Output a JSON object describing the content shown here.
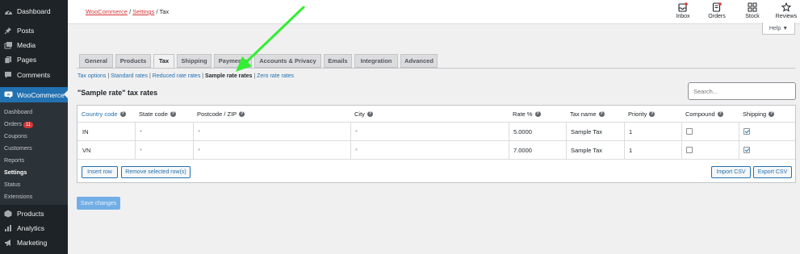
{
  "sidebar": {
    "top": [
      {
        "label": "Dashboard",
        "icon": "dashboard-icon"
      },
      {
        "label": "Posts",
        "icon": "pin-icon"
      },
      {
        "label": "Media",
        "icon": "media-icon"
      },
      {
        "label": "Pages",
        "icon": "pages-icon"
      },
      {
        "label": "Comments",
        "icon": "comment-icon"
      },
      {
        "label": "WooCommerce",
        "icon": "woo-icon"
      }
    ],
    "submenu": [
      "Dashboard",
      "Orders",
      "Coupons",
      "Customers",
      "Reports",
      "Settings",
      "Status",
      "Extensions"
    ],
    "orders_badge": "11",
    "bottom": [
      {
        "label": "Products",
        "icon": "products-icon"
      },
      {
        "label": "Analytics",
        "icon": "analytics-icon"
      },
      {
        "label": "Marketing",
        "icon": "marketing-icon"
      }
    ]
  },
  "breadcrumb": {
    "woocommerce": "WooCommerce",
    "settings": "Settings",
    "current": "Tax",
    "sep": "/"
  },
  "header_buttons": [
    {
      "label": "Inbox",
      "icon": "inbox-icon"
    },
    {
      "label": "Orders",
      "icon": "orders-icon"
    },
    {
      "label": "Stock",
      "icon": "stock-icon"
    },
    {
      "label": "Reviews",
      "icon": "star-icon"
    }
  ],
  "help": "Help ▼",
  "tabs": [
    "General",
    "Products",
    "Tax",
    "Shipping",
    "Payments",
    "Accounts & Privacy",
    "Emails",
    "Integration",
    "Advanced"
  ],
  "active_tab": "Tax",
  "subsub": {
    "items": [
      "Tax options",
      "Standard rates",
      "Reduced rate rates",
      "Sample rate rates",
      "Zero rate rates"
    ],
    "current": "Sample rate rates",
    "sep": " | "
  },
  "section_title": "\"Sample rate\" tax rates",
  "search_placeholder": "Search...",
  "table": {
    "headers": [
      "Country code",
      "State code",
      "Postcode / ZIP",
      "City",
      "Rate %",
      "Tax name",
      "Priority",
      "Compound",
      "Shipping"
    ],
    "rows": [
      {
        "country": "IN",
        "state": "*",
        "postcode": "*",
        "city": "*",
        "rate": "5.0000",
        "name": "Sample Tax",
        "priority": "1",
        "compound": false,
        "shipping": true
      },
      {
        "country": "VN",
        "state": "*",
        "postcode": "*",
        "city": "*",
        "rate": "7.0000",
        "name": "Sample Tax",
        "priority": "1",
        "compound": false,
        "shipping": true
      }
    ],
    "buttons": {
      "insert": "Insert row",
      "remove": "Remove selected row(s)",
      "import": "Import CSV",
      "export": "Export CSV"
    }
  },
  "save_label": "Save changes",
  "colors": {
    "accent": "#2271b1",
    "sidebar": "#1d2327",
    "arrow": "#33ee33"
  }
}
